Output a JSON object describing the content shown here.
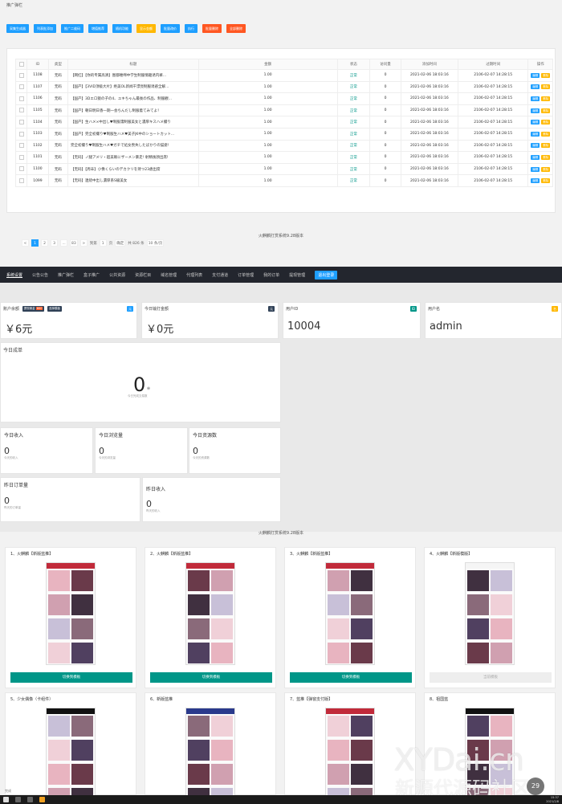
{
  "section1": {
    "breadcrumb": "推广弹栏",
    "toolbar": [
      {
        "label": "采集生成器",
        "color": "#1e9fff"
      },
      {
        "label": "列表批添加",
        "color": "#1e9fff"
      },
      {
        "label": "推广二维码",
        "color": "#1e9fff"
      },
      {
        "label": "增值推荐",
        "color": "#1e9fff"
      },
      {
        "label": "随机功能",
        "color": "#1e9fff"
      },
      {
        "label": "显示金额",
        "color": "#ffb800"
      },
      {
        "label": "批量改价",
        "color": "#1e9fff"
      },
      {
        "label": "执行",
        "color": "#1e9fff"
      },
      {
        "label": "批量删除",
        "color": "#ff5722"
      },
      {
        "label": "全部删除",
        "color": "#ff5722"
      }
    ],
    "table": {
      "headers": [
        "ID",
        "类型",
        "标题",
        "金额",
        "状态",
        "访问量",
        "添加时间",
        "过期时间",
        "操作"
      ],
      "rows": [
        {
          "id": "1108",
          "type": "无码",
          "title": "【网红】【你的专属高清】图都缠绵中学生制服情趣诱内裤...",
          "amount": "1.00",
          "status": "正常",
          "visits": "0",
          "added": "2021-02-06 18:03:16",
          "expires": "2106-02-07 14:28:15"
        },
        {
          "id": "1107",
          "type": "无码",
          "title": "【国产】【3VID顶级大片】绝美OL新闻干漂亮制服诱惑全解...",
          "amount": "1.00",
          "status": "正常",
          "visits": "0",
          "added": "2021-02-06 18:03:16",
          "expires": "2106-02-07 14:28:15"
        },
        {
          "id": "1106",
          "type": "无码",
          "title": "【国产】3Dエロ猿の子の4、ユキちゃん最後の作品、制服觀...",
          "amount": "1.00",
          "status": "正常",
          "visits": "0",
          "added": "2021-02-06 18:03:16",
          "expires": "2106-02-07 14:28:15"
        },
        {
          "id": "1105",
          "type": "无码",
          "title": "【国产】朝日明日香一期一会ちんだし制服着てみてよ！",
          "amount": "1.00",
          "status": "正常",
          "visits": "0",
          "added": "2021-02-06 18:03:16",
          "expires": "2106-02-07 14:28:15"
        },
        {
          "id": "1104",
          "type": "无码",
          "title": "【国产】生ハメ×中出し♥制服濡制服美女と濃厚キスハメ撮り",
          "amount": "1.00",
          "status": "正常",
          "visits": "0",
          "added": "2021-02-06 18:03:16",
          "expires": "2106-02-07 14:28:15"
        },
        {
          "id": "1103",
          "type": "无码",
          "title": "【国产】完全初撮り♥制服生ハメ♥美子JK中のショートカット...",
          "amount": "1.00",
          "status": "正常",
          "visits": "0",
          "added": "2021-02-06 18:03:16",
          "expires": "2106-02-07 14:28:15"
        },
        {
          "id": "1102",
          "type": "无码",
          "title": "完全初撮り♥制服生ハメ♥ガチで処女喪失したばかりの猫姿!",
          "amount": "1.00",
          "status": "正常",
          "visits": "0",
          "added": "2021-02-06 18:03:16",
          "expires": "2106-02-07 14:28:15"
        },
        {
          "id": "1101",
          "type": "无码",
          "title": "【无码】ノ腿アメリ・超美眼にザーメン暴走! 射精後顔出席!",
          "amount": "1.00",
          "status": "正常",
          "visits": "0",
          "added": "2021-02-06 18:03:16",
          "expires": "2106-02-07 14:28:15"
        },
        {
          "id": "1100",
          "type": "无码",
          "title": "【无码】【周辛】小像くらいのデカクリを持つ23歳出席",
          "amount": "1.00",
          "status": "正常",
          "visits": "0",
          "added": "2021-02-06 18:03:16",
          "expires": "2106-02-07 14:28:15"
        },
        {
          "id": "1099",
          "type": "无码",
          "title": "【无码】連続中出し濃厚系S級美女",
          "amount": "1.00",
          "status": "正常",
          "visits": "0",
          "added": "2021-02-06 18:03:16",
          "expires": "2106-02-07 14:28:15"
        }
      ],
      "action_edit": "编辑",
      "action_delete": "删除"
    },
    "pager": {
      "prev": "<",
      "pages": [
        "1",
        "2",
        "3",
        "...",
        "83"
      ],
      "next": ">",
      "goto": "到第",
      "page_value": "1",
      "page_unit": "页",
      "confirm": "确定",
      "total": "共 826 条",
      "per_page": "10 条/页"
    },
    "footer": "火麒麟打赏系统9.28版本"
  },
  "section2": {
    "nav": [
      "系统设置",
      "公告公告",
      "推广弹栏",
      "盒子推广",
      "公共资源",
      "资源栏目",
      "域名管理",
      "代理列表",
      "支付通道",
      "订单管理",
      "我的订单",
      "提现管理",
      "退出登录"
    ],
    "account_balance_label": "账户余额",
    "withdraw_chip": "提现佣金",
    "withdraw_amount": "600",
    "choose_template_chip": "选择模板",
    "balance_value": "￥6元",
    "today_withdraw_label": "今日输打金额",
    "today_withdraw_value": "￥0元",
    "user_id_label": "用户ID",
    "user_id_value": "10004",
    "username_label": "用户名",
    "username_value": "admin",
    "today_orders_label": "今日成单",
    "today_orders_value": "0",
    "today_orders_unit": "单",
    "today_orders_sub": "今日完成交易数",
    "cards": [
      {
        "title": "今日收入",
        "value": "0",
        "sub": "今天的收入"
      },
      {
        "title": "今日浏览量",
        "value": "0",
        "sub": "今天的浏览量"
      },
      {
        "title": "今日资源数",
        "value": "0",
        "sub": "今天的资源数"
      }
    ],
    "yesterday_orders": {
      "title": "昨日订单量",
      "value": "0",
      "sub": "昨天的订单量"
    },
    "yesterday_income": {
      "title": "昨日收入",
      "value": "0",
      "sub": "昨天的收入"
    },
    "footer": "火麒麟打赏系统9.28版本"
  },
  "section3": {
    "templates": [
      {
        "title": "1、火麒麟【新版蓝推】",
        "button": "切换到模板",
        "enabled": true,
        "head": "red"
      },
      {
        "title": "2、火麒麟【新版蓝推】",
        "button": "切换到模板",
        "enabled": true,
        "head": "red"
      },
      {
        "title": "3、火麒麟【新版蓝推】",
        "button": "切换到模板",
        "enabled": true,
        "head": "red"
      },
      {
        "title": "4、火麒麟【新版模版】",
        "button": "当前模板",
        "enabled": false,
        "head": "white"
      },
      {
        "title": "5、少女偶像（卡组件）",
        "button": "",
        "enabled": true,
        "head": "dark"
      },
      {
        "title": "6、新版蓝推",
        "button": "",
        "enabled": true,
        "head": "blue"
      },
      {
        "title": "7、蓝推【弹窗支付版】",
        "button": "",
        "enabled": true,
        "head": "red"
      },
      {
        "title": "8、祖国蓝",
        "button": "",
        "enabled": true,
        "head": "dark"
      }
    ]
  },
  "watermark": {
    "line1": "XYDai.cn",
    "line2": "新源代源码社区"
  },
  "badge": "29",
  "status_text": "完成",
  "clock": {
    "time": "15:37",
    "date": "2021/2/8"
  }
}
